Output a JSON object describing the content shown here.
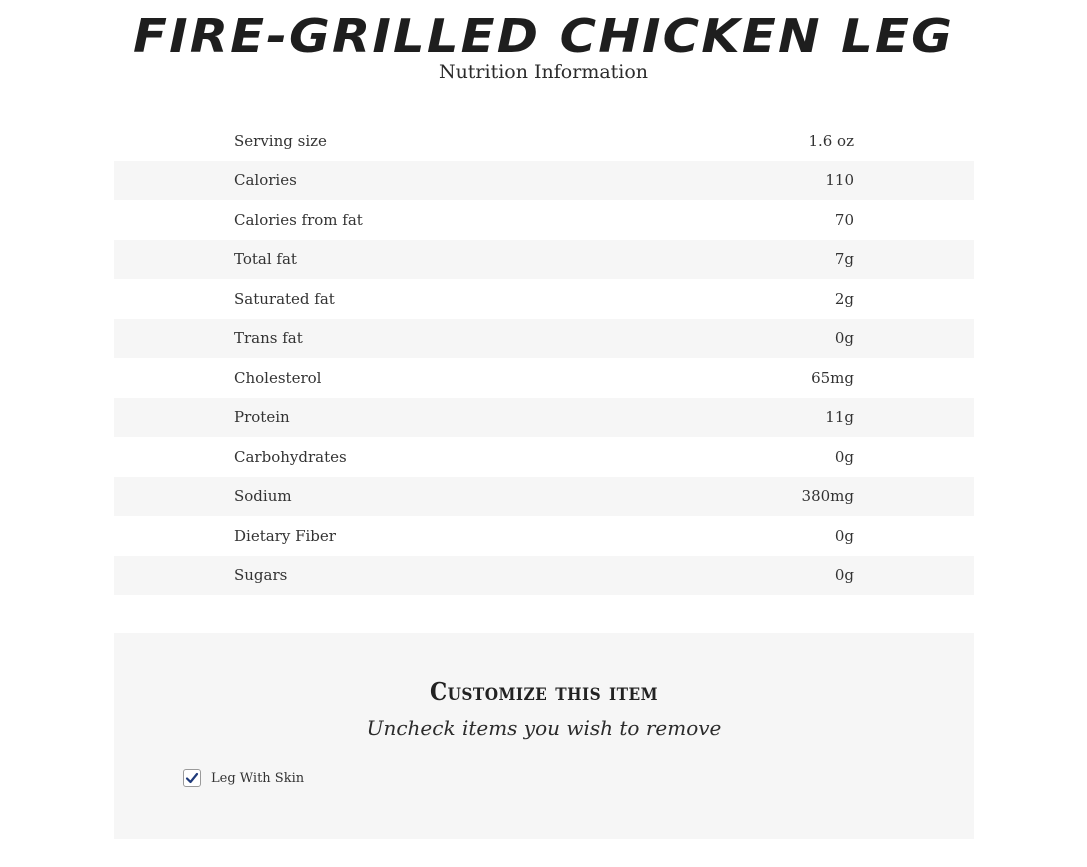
{
  "header": {
    "title": "FIRE-GRILLED CHICKEN LEG",
    "subtitle": "Nutrition Information"
  },
  "nutrition": {
    "rows": [
      {
        "label": "Serving size",
        "value": "1.6 oz"
      },
      {
        "label": "Calories",
        "value": "110"
      },
      {
        "label": "Calories from fat",
        "value": "70"
      },
      {
        "label": "Total fat",
        "value": "7g"
      },
      {
        "label": "Saturated fat",
        "value": "2g"
      },
      {
        "label": "Trans fat",
        "value": "0g"
      },
      {
        "label": "Cholesterol",
        "value": "65mg"
      },
      {
        "label": "Protein",
        "value": "11g"
      },
      {
        "label": "Carbohydrates",
        "value": "0g"
      },
      {
        "label": "Sodium",
        "value": "380mg"
      },
      {
        "label": "Dietary Fiber",
        "value": "0g"
      },
      {
        "label": "Sugars",
        "value": "0g"
      }
    ]
  },
  "customize": {
    "title": "Customize this item",
    "subtitle": "Uncheck items you wish to remove",
    "options": [
      {
        "label": "Leg With Skin",
        "checked": true,
        "icon": "checkmark-icon"
      }
    ]
  },
  "colors": {
    "row_shade": "#f6f6f6",
    "check": "#1f3a7a",
    "text": "#2b2b2b"
  }
}
